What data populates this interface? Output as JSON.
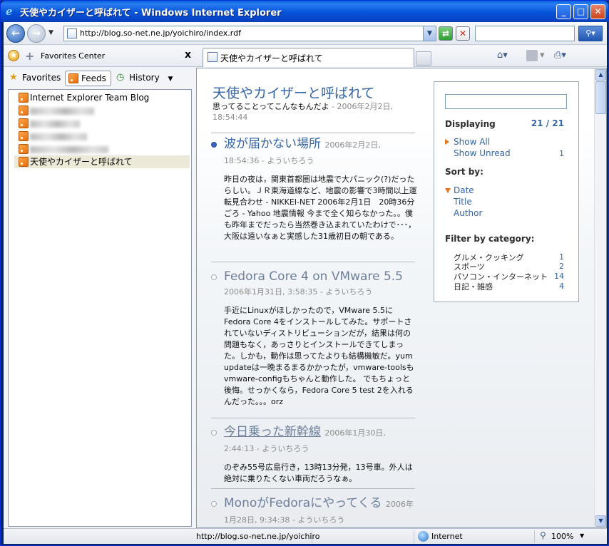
{
  "window": {
    "title": "天使やカイザーと呼ばれて - Windows Internet Explorer",
    "minimize": "_",
    "maximize": "□",
    "close": "✕"
  },
  "nav": {
    "back_icon": "back-arrow-icon",
    "forward_icon": "forward-arrow-icon",
    "url": "http://blog.so-net.ne.jp/yoichiro/index.rdf",
    "search_placeholder": ""
  },
  "tabs": {
    "favorites_center": "Favorites Center",
    "close_label": "x",
    "active_tab": "天使やカイザーと呼ばれて"
  },
  "favpane": {
    "tabs": [
      "Favorites",
      "Feeds",
      "History"
    ],
    "feeds": [
      {
        "label": "Internet Explorer Team Blog",
        "blurred": false
      },
      {
        "label": "",
        "blurred": true
      },
      {
        "label": "",
        "blurred": true
      },
      {
        "label": "",
        "blurred": true
      },
      {
        "label": "",
        "blurred": true
      },
      {
        "label": "天使やカイザーと呼ばれて",
        "blurred": false,
        "selected": true
      }
    ]
  },
  "feed": {
    "title": "天使やカイザーと呼ばれて",
    "subtitle": "思ってることってこんなもんだよ",
    "subtitle_date": " - 2006年2月2日, 18:54:44",
    "entries": [
      {
        "title": "波が届かない場所",
        "meta": "2006年2月2日, 18:54:36 - よういちろう",
        "unread": true,
        "body": "昨日の夜は，関東首都圏は地震で大パニック(?)だったらしい。ＪＲ東海道線など、地震の影響で3時間以上運転見合わせ - NIKKEI-NET 2006年2月1日　20時36分ごろ - Yahoo 地震情報 今まで全く知らなかった。。僕も昨年までだったら当然巻き込まれていたわけで･･･，大阪は遠いなぁと実感した31歳初日の朝である。"
      },
      {
        "title": "Fedora Core 4 on VMware 5.5",
        "meta": "2006年1月31日, 3:58:35 - よういちろう",
        "unread": false,
        "body": "手近にLinuxがほしかったので，VMware 5.5にFedora Core 4をインストールしてみた。サポートされていないディストリビューションだが，結果は何の問題もなく，あっさりとインストールできてしまった。しかも，動作は思ってたよりも結構機敏だ。yum updateは一晩まるまるかかったが，vmware-toolsもvmware-configもちゃんと動作した。 でもちょっと後悔。せっかくなら，Fedora Core 5 test 2を入れるんだった。。。orz"
      },
      {
        "title": "今日乗った新幹線",
        "meta": "2006年1月30日, 2:44:13 - よういちろう",
        "unread": false,
        "body": "のぞみ55号広島行き，13時13分発，13号車。外人は絶対に乗りたくない車両だろうなぁ。"
      },
      {
        "title": "MonoがFedoraにやってくる",
        "meta": "2006年1月28日, 9:34:38 - よういちろう",
        "unread": false,
        "body": ""
      }
    ]
  },
  "filter": {
    "displaying_label": "Displaying",
    "displaying_count": "21 / 21",
    "show_all": "Show All",
    "show_unread": "Show Unread",
    "unread_count": "1",
    "sort_by": "Sort by:",
    "sort_options": [
      "Date",
      "Title",
      "Author"
    ],
    "filter_by": "Filter by category:",
    "categories": [
      {
        "name": "グルメ・クッキング",
        "count": "1"
      },
      {
        "name": "スポーツ",
        "count": "2"
      },
      {
        "name": "パソコン・インターネット",
        "count": "14"
      },
      {
        "name": "日記・雑感",
        "count": "4"
      }
    ]
  },
  "status": {
    "url": "http://blog.so-net.ne.jp/yoichiro",
    "zone": "Internet",
    "zoom": "100%"
  }
}
